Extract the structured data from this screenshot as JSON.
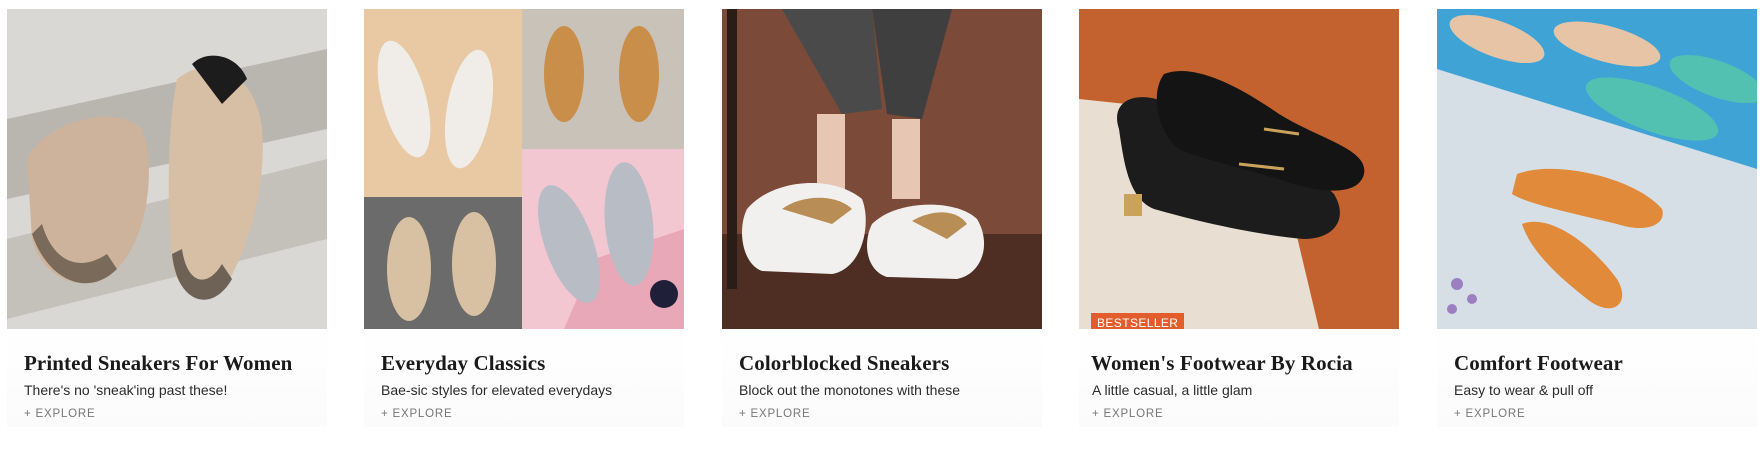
{
  "cards": [
    {
      "title": "Printed Sneakers For Women",
      "subtitle": "There's no 'sneak'ing past these!",
      "cta": "+ EXPLORE",
      "image_icon": "sneaker-image"
    },
    {
      "title": "Everyday Classics",
      "subtitle": "Bae-sic styles for elevated everydays",
      "cta": "+ EXPLORE",
      "image_icon": "sandals-collage-image"
    },
    {
      "title": "Colorblocked Sneakers",
      "subtitle": "Block out the monotones with these",
      "cta": "+ EXPLORE",
      "image_icon": "chunky-sneakers-image"
    },
    {
      "title": "Women's Footwear By Rocia",
      "subtitle": "A little casual, a little glam",
      "cta": "+ EXPLORE",
      "badge": "BESTSELLER",
      "image_icon": "black-loafers-image"
    },
    {
      "title": "Comfort Footwear",
      "subtitle": "Easy to wear & pull off",
      "cta": "+ EXPLORE",
      "image_icon": "flats-image"
    }
  ],
  "colors": {
    "badge": "#e25d2b",
    "title": "#1a1a1a",
    "cta": "#777777"
  }
}
